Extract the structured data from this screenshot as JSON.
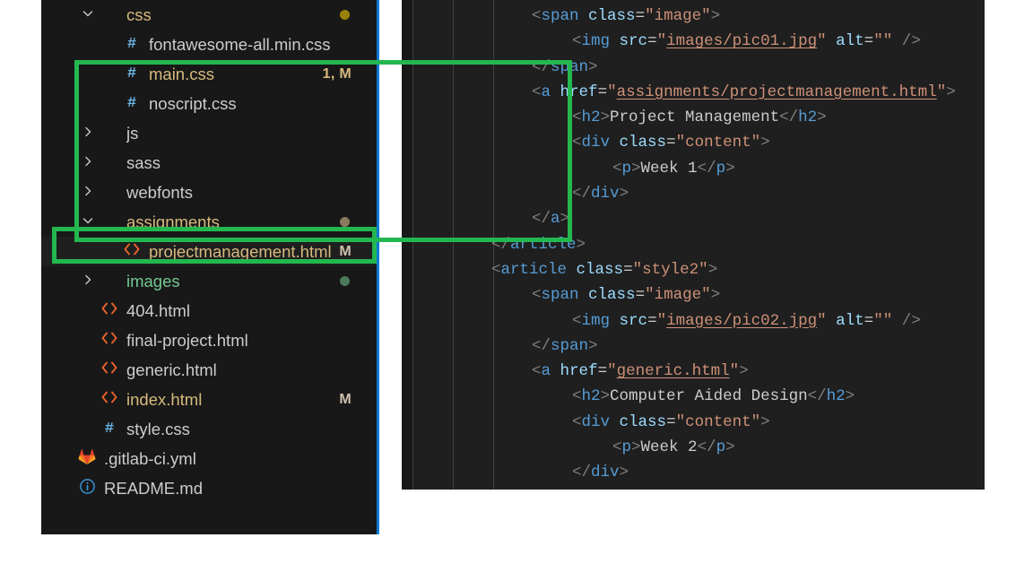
{
  "explorer": {
    "name": "file-explorer",
    "items": [
      {
        "indent": 1,
        "twisty": "chevron-down-icon",
        "twisty_glyph": "∨",
        "icon": "folder-css",
        "icon_glyph": "",
        "label": "css",
        "label_color": "#d7ba7d",
        "badge": "",
        "dot": "#9a8108"
      },
      {
        "indent": 2,
        "twisty": "",
        "twisty_glyph": "",
        "icon": "hash-icon",
        "icon_glyph": "#",
        "label": "fontawesome-all.min.css",
        "label_color": "#cccccc",
        "badge": "",
        "dot": ""
      },
      {
        "indent": 2,
        "twisty": "",
        "twisty_glyph": "",
        "icon": "hash-icon",
        "icon_glyph": "#",
        "label": "main.css",
        "label_color": "#d7ba7d",
        "badge": "1, M",
        "badge_color": "#d7ba7d",
        "dot": ""
      },
      {
        "indent": 2,
        "twisty": "",
        "twisty_glyph": "",
        "icon": "hash-icon",
        "icon_glyph": "#",
        "label": "noscript.css",
        "label_color": "#cccccc",
        "badge": "",
        "dot": ""
      },
      {
        "indent": 1,
        "twisty": "chevron-right-icon",
        "twisty_glyph": "〉",
        "icon": "folder-js",
        "icon_glyph": "",
        "label": "js",
        "label_color": "#cccccc",
        "badge": "",
        "dot": ""
      },
      {
        "indent": 1,
        "twisty": "chevron-right-icon",
        "twisty_glyph": "〉",
        "icon": "folder-sass",
        "icon_glyph": "",
        "label": "sass",
        "label_color": "#cccccc",
        "badge": "",
        "dot": ""
      },
      {
        "indent": 1,
        "twisty": "chevron-right-icon",
        "twisty_glyph": "〉",
        "icon": "folder-webfonts",
        "icon_glyph": "",
        "label": "webfonts",
        "label_color": "#cccccc",
        "badge": "",
        "dot": ""
      },
      {
        "indent": 1,
        "twisty": "chevron-down-icon",
        "twisty_glyph": "∨",
        "icon": "folder-assignments",
        "icon_glyph": "",
        "label": "assignments",
        "label_color": "#d7ba7d",
        "badge": "",
        "dot": "#8a7a5e"
      },
      {
        "indent": 2,
        "twisty": "",
        "twisty_glyph": "",
        "icon": "code-file-icon",
        "icon_glyph": "<>",
        "label": "projectmanagement.html",
        "label_color": "#d7ba7d",
        "badge": "M",
        "badge_color": "#d0c0ae",
        "dot": "",
        "selected": true
      },
      {
        "indent": 1,
        "twisty": "chevron-right-icon",
        "twisty_glyph": "〉",
        "icon": "folder-images",
        "icon_glyph": "",
        "label": "images",
        "label_color": "#73c991",
        "badge": "",
        "dot": "#4a7a58"
      },
      {
        "indent": 1,
        "twisty": "",
        "twisty_glyph": "",
        "icon": "code-file-icon",
        "icon_glyph": "<>",
        "label": "404.html",
        "label_color": "#cccccc",
        "badge": "",
        "dot": ""
      },
      {
        "indent": 1,
        "twisty": "",
        "twisty_glyph": "",
        "icon": "code-file-icon",
        "icon_glyph": "<>",
        "label": "final-project.html",
        "label_color": "#cccccc",
        "badge": "",
        "dot": ""
      },
      {
        "indent": 1,
        "twisty": "",
        "twisty_glyph": "",
        "icon": "code-file-icon",
        "icon_glyph": "<>",
        "label": "generic.html",
        "label_color": "#cccccc",
        "badge": "",
        "dot": ""
      },
      {
        "indent": 1,
        "twisty": "",
        "twisty_glyph": "",
        "icon": "code-file-icon",
        "icon_glyph": "<>",
        "label": "index.html",
        "label_color": "#d7ba7d",
        "badge": "M",
        "badge_color": "#d0c0ae",
        "dot": ""
      },
      {
        "indent": 1,
        "twisty": "",
        "twisty_glyph": "",
        "icon": "hash-icon",
        "icon_glyph": "#",
        "label": "style.css",
        "label_color": "#cccccc",
        "badge": "",
        "dot": ""
      },
      {
        "indent": 0,
        "twisty": "",
        "twisty_glyph": "",
        "icon": "gitlab-fox-icon",
        "icon_glyph": "",
        "label": ".gitlab-ci.yml",
        "label_color": "#cccccc",
        "badge": "",
        "dot": ""
      },
      {
        "indent": 0,
        "twisty": "",
        "twisty_glyph": "",
        "icon": "info-circle-icon",
        "icon_glyph": "ⓘ",
        "label": "README.md",
        "label_color": "#cccccc",
        "badge": "",
        "dot": ""
      }
    ],
    "selected_item_label": "projectmanagement.html"
  },
  "editor": {
    "name": "code-editor",
    "language": "html",
    "lines": [
      {
        "n": 1,
        "indent": 1,
        "tokens": [
          {
            "t": "pu",
            "v": "<"
          },
          {
            "t": "tag",
            "v": "span"
          },
          {
            "t": "txt",
            "v": " "
          },
          {
            "t": "att",
            "v": "class"
          },
          {
            "t": "eq",
            "v": "="
          },
          {
            "t": "str",
            "v": "\"image\""
          },
          {
            "t": "pu",
            "v": ">"
          }
        ]
      },
      {
        "n": 2,
        "indent": 2,
        "tokens": [
          {
            "t": "pu",
            "v": "<"
          },
          {
            "t": "tag",
            "v": "img"
          },
          {
            "t": "txt",
            "v": " "
          },
          {
            "t": "att",
            "v": "src"
          },
          {
            "t": "eq",
            "v": "="
          },
          {
            "t": "str",
            "v": "\""
          },
          {
            "t": "lnk",
            "v": "images/pic01.jpg"
          },
          {
            "t": "str",
            "v": "\""
          },
          {
            "t": "txt",
            "v": " "
          },
          {
            "t": "att",
            "v": "alt"
          },
          {
            "t": "eq",
            "v": "="
          },
          {
            "t": "str",
            "v": "\"\""
          },
          {
            "t": "txt",
            "v": " "
          },
          {
            "t": "pu",
            "v": "/>"
          }
        ]
      },
      {
        "n": 3,
        "indent": 1,
        "tokens": [
          {
            "t": "pu",
            "v": "</"
          },
          {
            "t": "tag",
            "v": "span"
          },
          {
            "t": "pu",
            "v": ">"
          }
        ]
      },
      {
        "n": 4,
        "indent": 1,
        "tokens": [
          {
            "t": "pu",
            "v": "<"
          },
          {
            "t": "tag",
            "v": "a"
          },
          {
            "t": "txt",
            "v": " "
          },
          {
            "t": "att",
            "v": "href"
          },
          {
            "t": "eq",
            "v": "="
          },
          {
            "t": "str",
            "v": "\""
          },
          {
            "t": "lnk",
            "v": "assignments/projectmanagement.html"
          },
          {
            "t": "str",
            "v": "\""
          },
          {
            "t": "pu",
            "v": ">"
          }
        ]
      },
      {
        "n": 5,
        "indent": 2,
        "tokens": [
          {
            "t": "pu",
            "v": "<"
          },
          {
            "t": "tag",
            "v": "h2"
          },
          {
            "t": "pu",
            "v": ">"
          },
          {
            "t": "txt",
            "v": "Project Management"
          },
          {
            "t": "pu",
            "v": "</"
          },
          {
            "t": "tag",
            "v": "h2"
          },
          {
            "t": "pu",
            "v": ">"
          }
        ]
      },
      {
        "n": 6,
        "indent": 2,
        "tokens": [
          {
            "t": "pu",
            "v": "<"
          },
          {
            "t": "tag",
            "v": "div"
          },
          {
            "t": "txt",
            "v": " "
          },
          {
            "t": "att",
            "v": "class"
          },
          {
            "t": "eq",
            "v": "="
          },
          {
            "t": "str",
            "v": "\"content\""
          },
          {
            "t": "pu",
            "v": ">"
          }
        ]
      },
      {
        "n": 7,
        "indent": 3,
        "tokens": [
          {
            "t": "pu",
            "v": "<"
          },
          {
            "t": "tag",
            "v": "p"
          },
          {
            "t": "pu",
            "v": ">"
          },
          {
            "t": "txt",
            "v": "Week 1"
          },
          {
            "t": "pu",
            "v": "</"
          },
          {
            "t": "tag",
            "v": "p"
          },
          {
            "t": "pu",
            "v": ">"
          }
        ]
      },
      {
        "n": 8,
        "indent": 2,
        "tokens": [
          {
            "t": "pu",
            "v": "</"
          },
          {
            "t": "tag",
            "v": "div"
          },
          {
            "t": "pu",
            "v": ">"
          }
        ]
      },
      {
        "n": 9,
        "indent": 1,
        "tokens": [
          {
            "t": "pu",
            "v": "</"
          },
          {
            "t": "tag",
            "v": "a"
          },
          {
            "t": "pu",
            "v": ">"
          }
        ]
      },
      {
        "n": 10,
        "indent": 0,
        "tokens": [
          {
            "t": "pu",
            "v": "</"
          },
          {
            "t": "tag",
            "v": "article"
          },
          {
            "t": "pu",
            "v": ">"
          }
        ]
      },
      {
        "n": 11,
        "indent": 0,
        "tokens": [
          {
            "t": "pu",
            "v": "<"
          },
          {
            "t": "tag",
            "v": "article"
          },
          {
            "t": "txt",
            "v": " "
          },
          {
            "t": "att",
            "v": "class"
          },
          {
            "t": "eq",
            "v": "="
          },
          {
            "t": "str",
            "v": "\"style2\""
          },
          {
            "t": "pu",
            "v": ">"
          }
        ]
      },
      {
        "n": 12,
        "indent": 1,
        "tokens": [
          {
            "t": "pu",
            "v": "<"
          },
          {
            "t": "tag",
            "v": "span"
          },
          {
            "t": "txt",
            "v": " "
          },
          {
            "t": "att",
            "v": "class"
          },
          {
            "t": "eq",
            "v": "="
          },
          {
            "t": "str",
            "v": "\"image\""
          },
          {
            "t": "pu",
            "v": ">"
          }
        ]
      },
      {
        "n": 13,
        "indent": 2,
        "tokens": [
          {
            "t": "pu",
            "v": "<"
          },
          {
            "t": "tag",
            "v": "img"
          },
          {
            "t": "txt",
            "v": " "
          },
          {
            "t": "att",
            "v": "src"
          },
          {
            "t": "eq",
            "v": "="
          },
          {
            "t": "str",
            "v": "\""
          },
          {
            "t": "lnk",
            "v": "images/pic02.jpg"
          },
          {
            "t": "str",
            "v": "\""
          },
          {
            "t": "txt",
            "v": " "
          },
          {
            "t": "att",
            "v": "alt"
          },
          {
            "t": "eq",
            "v": "="
          },
          {
            "t": "str",
            "v": "\"\""
          },
          {
            "t": "txt",
            "v": " "
          },
          {
            "t": "pu",
            "v": "/>"
          }
        ]
      },
      {
        "n": 14,
        "indent": 1,
        "tokens": [
          {
            "t": "pu",
            "v": "</"
          },
          {
            "t": "tag",
            "v": "span"
          },
          {
            "t": "pu",
            "v": ">"
          }
        ]
      },
      {
        "n": 15,
        "indent": 1,
        "tokens": [
          {
            "t": "pu",
            "v": "<"
          },
          {
            "t": "tag",
            "v": "a"
          },
          {
            "t": "txt",
            "v": " "
          },
          {
            "t": "att",
            "v": "href"
          },
          {
            "t": "eq",
            "v": "="
          },
          {
            "t": "str",
            "v": "\""
          },
          {
            "t": "lnk",
            "v": "generic.html"
          },
          {
            "t": "str",
            "v": "\""
          },
          {
            "t": "pu",
            "v": ">"
          }
        ]
      },
      {
        "n": 16,
        "indent": 2,
        "tokens": [
          {
            "t": "pu",
            "v": "<"
          },
          {
            "t": "tag",
            "v": "h2"
          },
          {
            "t": "pu",
            "v": ">"
          },
          {
            "t": "txt",
            "v": "Computer Aided Design"
          },
          {
            "t": "pu",
            "v": "</"
          },
          {
            "t": "tag",
            "v": "h2"
          },
          {
            "t": "pu",
            "v": ">"
          }
        ]
      },
      {
        "n": 17,
        "indent": 2,
        "tokens": [
          {
            "t": "pu",
            "v": "<"
          },
          {
            "t": "tag",
            "v": "div"
          },
          {
            "t": "txt",
            "v": " "
          },
          {
            "t": "att",
            "v": "class"
          },
          {
            "t": "eq",
            "v": "="
          },
          {
            "t": "str",
            "v": "\"content\""
          },
          {
            "t": "pu",
            "v": ">"
          }
        ]
      },
      {
        "n": 18,
        "indent": 3,
        "tokens": [
          {
            "t": "pu",
            "v": "<"
          },
          {
            "t": "tag",
            "v": "p"
          },
          {
            "t": "pu",
            "v": ">"
          },
          {
            "t": "txt",
            "v": "Week 2"
          },
          {
            "t": "pu",
            "v": "</"
          },
          {
            "t": "tag",
            "v": "p"
          },
          {
            "t": "pu",
            "v": ">"
          }
        ]
      },
      {
        "n": 19,
        "indent": 2,
        "tokens": [
          {
            "t": "pu",
            "v": "</"
          },
          {
            "t": "tag",
            "v": "div"
          },
          {
            "t": "pu",
            "v": ">"
          }
        ]
      }
    ]
  },
  "annotations": {
    "highlight_color": "#23b84f",
    "sidebar_box_target": "projectmanagement.html",
    "editor_box_target_lines": [
      3,
      9
    ]
  }
}
